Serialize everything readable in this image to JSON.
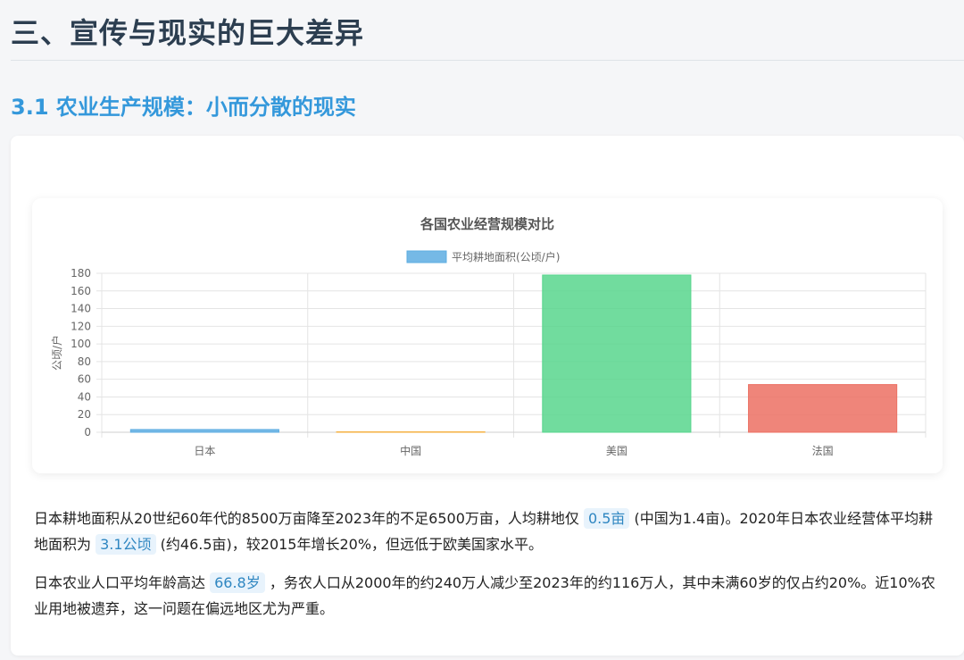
{
  "page": {
    "heading": "三、宣传与现实的巨大差异",
    "subheading": "3.1 农业生产规模：小而分散的现实"
  },
  "chart_data": {
    "type": "bar",
    "title": "各国农业经营规模对比",
    "categories": [
      "日本",
      "中国",
      "美国",
      "法国"
    ],
    "series": [
      {
        "name": "平均耕地面积(公顷/户)",
        "values": [
          3.1,
          0.5,
          178,
          54
        ]
      }
    ],
    "bar_colors": [
      "#5dade2",
      "#f5b041",
      "#58d68d",
      "#ec7063"
    ],
    "legend_color": "#5dade2",
    "ylabel": "公顷/户",
    "xlabel": "",
    "ylim": [
      0,
      180
    ],
    "yticks": [
      0,
      20,
      40,
      60,
      80,
      100,
      120,
      140,
      160,
      180
    ],
    "grid": true,
    "legend_position": "top-center"
  },
  "paragraphs": {
    "p1": {
      "a": "日本耕地面积从20世纪60年代的8500万亩降至2023年的不足6500万亩，人均耕地仅",
      "h1": "0.5亩",
      "b": "(中国为1.4亩)。2020年日本农业经营体平均耕地面积为",
      "h2": "3.1公顷",
      "c": "(约46.5亩)，较2015年增长20%，但远低于欧美国家水平。"
    },
    "p2": {
      "a": "日本农业人口平均年龄高达",
      "h1": "66.8岁",
      "b": "，务农人口从2000年的约240万人减少至2023年的约116万人，其中未满60岁的仅占约20%。近10%农业用地被遗弃，这一问题在偏远地区尤为严重。"
    }
  }
}
